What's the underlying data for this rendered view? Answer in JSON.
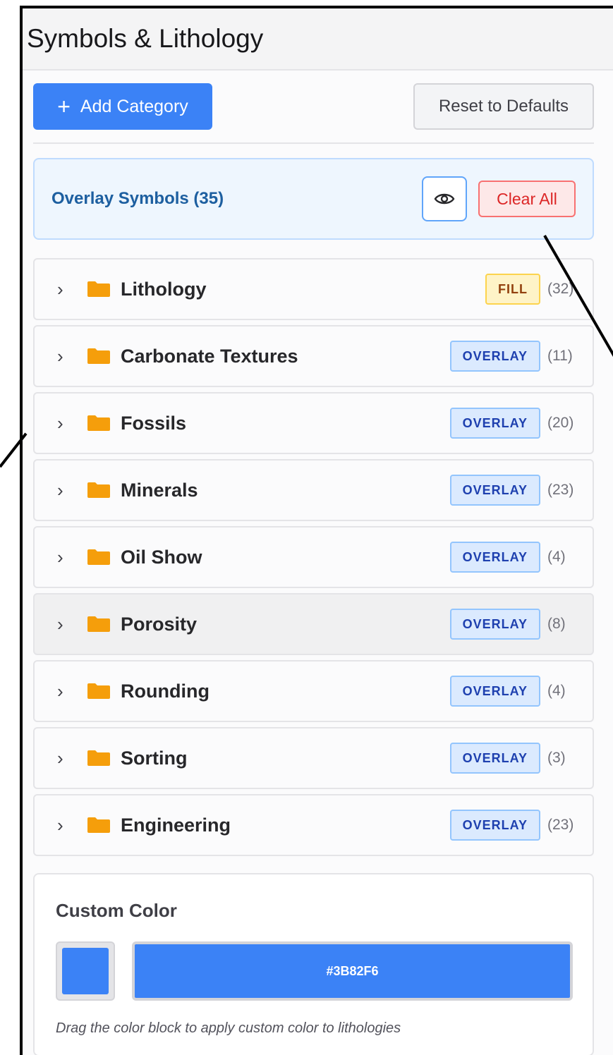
{
  "panel": {
    "title": "Symbols & Lithology"
  },
  "toolbar": {
    "add_label": "Add Category",
    "reset_label": "Reset to Defaults"
  },
  "overlay": {
    "title": "Overlay Symbols (35)",
    "clear_label": "Clear All",
    "visibility_icon": "eye-icon"
  },
  "categories": [
    {
      "name": "Lithology",
      "badge": "FILL",
      "count": "(32)"
    },
    {
      "name": "Carbonate Textures",
      "badge": "OVERLAY",
      "count": "(11)"
    },
    {
      "name": "Fossils",
      "badge": "OVERLAY",
      "count": "(20)"
    },
    {
      "name": "Minerals",
      "badge": "OVERLAY",
      "count": "(23)"
    },
    {
      "name": "Oil Show",
      "badge": "OVERLAY",
      "count": "(4)"
    },
    {
      "name": "Porosity",
      "badge": "OVERLAY",
      "count": "(8)"
    },
    {
      "name": "Rounding",
      "badge": "OVERLAY",
      "count": "(4)"
    },
    {
      "name": "Sorting",
      "badge": "OVERLAY",
      "count": "(3)"
    },
    {
      "name": "Engineering",
      "badge": "OVERLAY",
      "count": "(23)"
    }
  ],
  "custom_color": {
    "title": "Custom Color",
    "hex": "#3B82F6",
    "hint": "Drag the color block to apply custom color to lithologies"
  },
  "colors": {
    "accent": "#3b82f6",
    "folder": "#f59e0b",
    "danger": "#dc2626"
  }
}
